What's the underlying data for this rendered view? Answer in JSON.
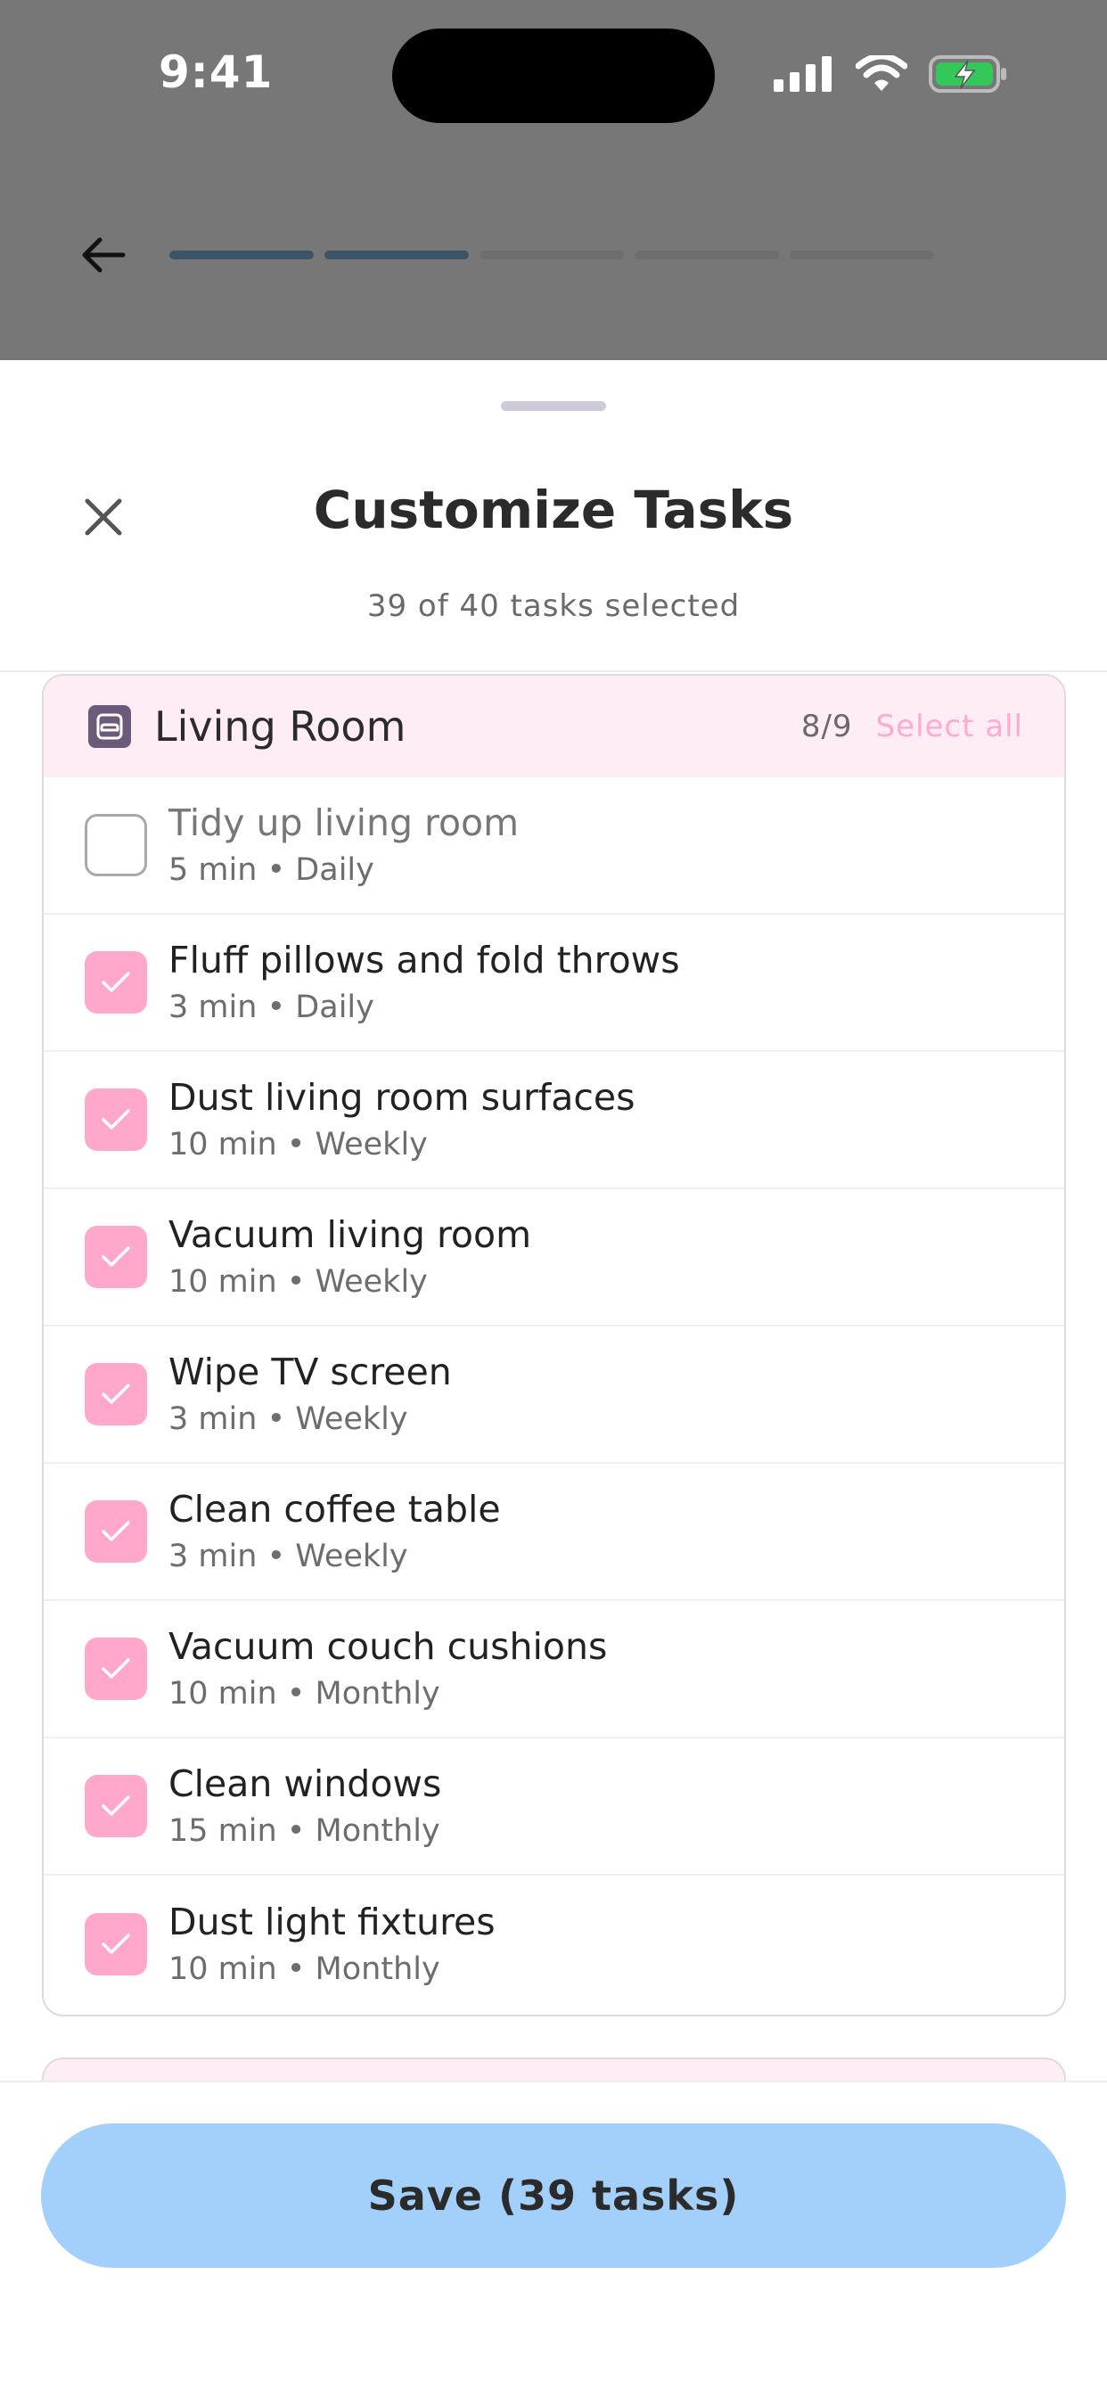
{
  "status_bar": {
    "time": "9:41",
    "icons": [
      "cellular-signal-icon",
      "wifi-icon",
      "battery-charging-icon"
    ]
  },
  "background_screen": {
    "back_icon": "arrow-left-icon",
    "progress_segments": [
      true,
      true,
      false,
      false,
      false
    ]
  },
  "sheet": {
    "title": "Customize Tasks",
    "subtitle": "39 of 40 tasks selected",
    "close_icon": "close-icon"
  },
  "room": {
    "name": "Living Room",
    "icon": "sofa-icon",
    "count": "8/9",
    "select_all": "Select all",
    "tasks": [
      {
        "name": "Tidy up living room",
        "meta": "5 min • Daily",
        "checked": false
      },
      {
        "name": "Fluff pillows and fold throws",
        "meta": "3 min • Daily",
        "checked": true
      },
      {
        "name": "Dust living room surfaces",
        "meta": "10 min • Weekly",
        "checked": true
      },
      {
        "name": "Vacuum living room",
        "meta": "10 min • Weekly",
        "checked": true
      },
      {
        "name": "Wipe TV screen",
        "meta": "3 min • Weekly",
        "checked": true
      },
      {
        "name": "Clean coffee table",
        "meta": "3 min • Weekly",
        "checked": true
      },
      {
        "name": "Vacuum couch cushions",
        "meta": "10 min • Monthly",
        "checked": true
      },
      {
        "name": "Clean windows",
        "meta": "15 min • Monthly",
        "checked": true
      },
      {
        "name": "Dust light fixtures",
        "meta": "10 min • Monthly",
        "checked": true
      }
    ]
  },
  "footer": {
    "save_label": "Save (39 tasks)"
  },
  "colors": {
    "accent_pink": "#ffa8cc",
    "header_pink": "#ffedf5",
    "save_blue": "#a3d0fa",
    "progress_active": "#3d5466"
  }
}
